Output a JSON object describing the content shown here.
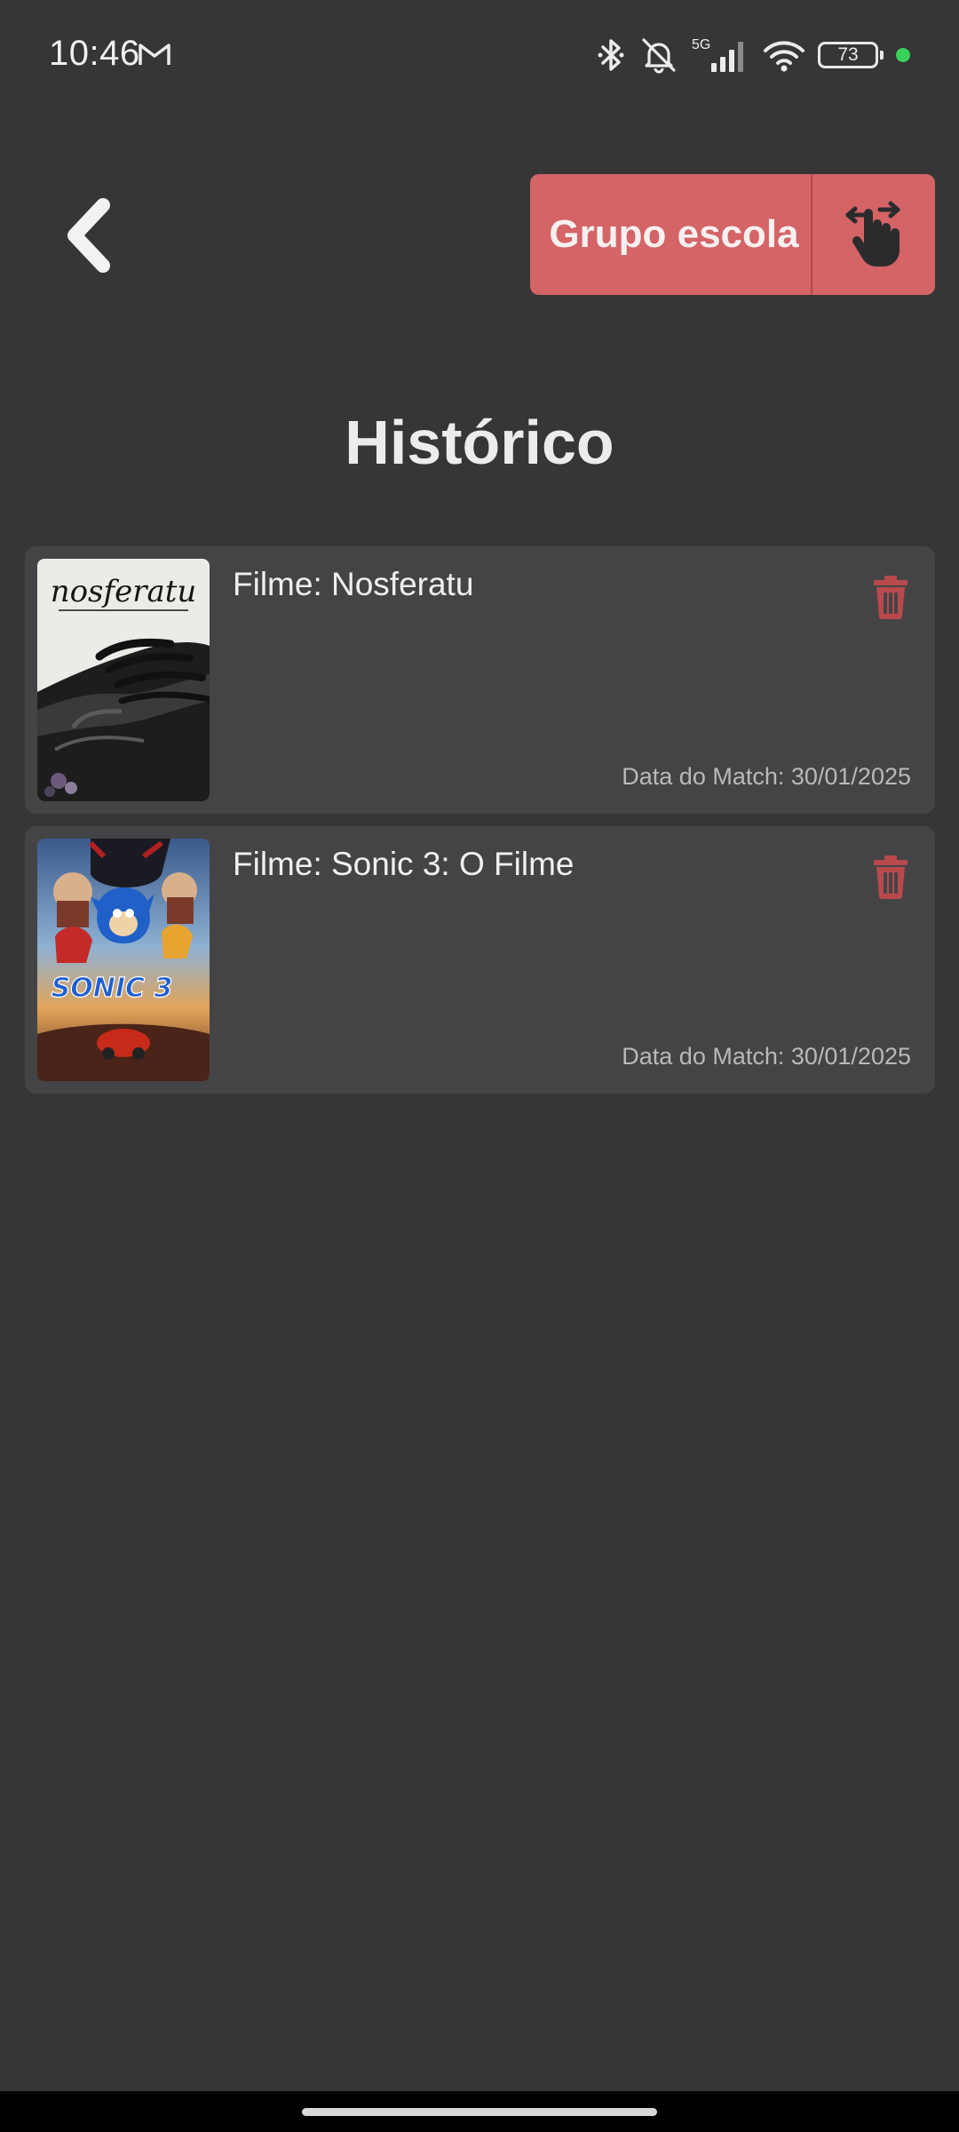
{
  "status_bar": {
    "time": "10:46",
    "network_label": "5G",
    "battery": "73",
    "icons": [
      "gmail-icon",
      "bluetooth-icon",
      "mute-icon",
      "signal-icon",
      "wifi-icon",
      "battery-icon"
    ],
    "dot_color": "#3ad15a"
  },
  "header": {
    "back_icon": "chevron-left-icon",
    "group_button_label": "Grupo escola",
    "group_button_icon": "swipe-hand-icon",
    "accent_color": "#d46466"
  },
  "page": {
    "title": "Histórico"
  },
  "history": [
    {
      "title": "Filme: Nosferatu",
      "date": "Data do Match: 30/01/2025",
      "poster_title": "nosferatu",
      "delete_icon": "trash-icon"
    },
    {
      "title": "Filme: Sonic 3: O Filme",
      "date": "Data do Match: 30/01/2025",
      "poster_title": "SONIC 3",
      "delete_icon": "trash-icon"
    }
  ]
}
